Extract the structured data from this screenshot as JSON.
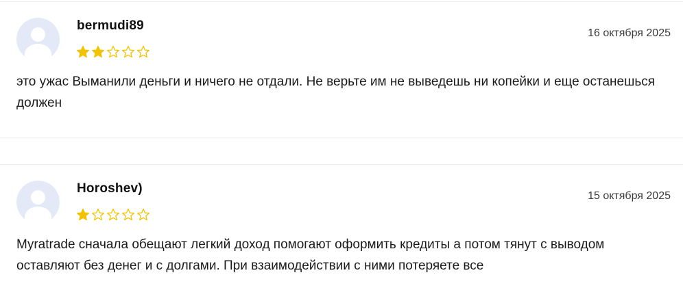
{
  "reviews": [
    {
      "username": "bermudi89",
      "date": "16 октября 2025",
      "rating": 2,
      "max_rating": 5,
      "text": "это ужас Выманили деньги и ничего не отдали. Не верьте им не выведешь ни копейки и еще останешься должен"
    },
    {
      "username": "Horoshev)",
      "date": "15 октября 2025",
      "rating": 1,
      "max_rating": 5,
      "text": "Myratrade сначала обещают легкий доход помогают оформить кредиты а потом тянут с выводом оставляют без денег и с долгами. При взаимодействии с ними потеряете все"
    }
  ],
  "colors": {
    "star_filled": "#f2c200",
    "star_empty_stroke": "#f2c200",
    "avatar_bg": "#e3e9f6",
    "divider": "#ececec"
  },
  "icons": {
    "avatar": "user-avatar-icon",
    "star_filled": "star-filled-icon",
    "star_empty": "star-outline-icon"
  }
}
